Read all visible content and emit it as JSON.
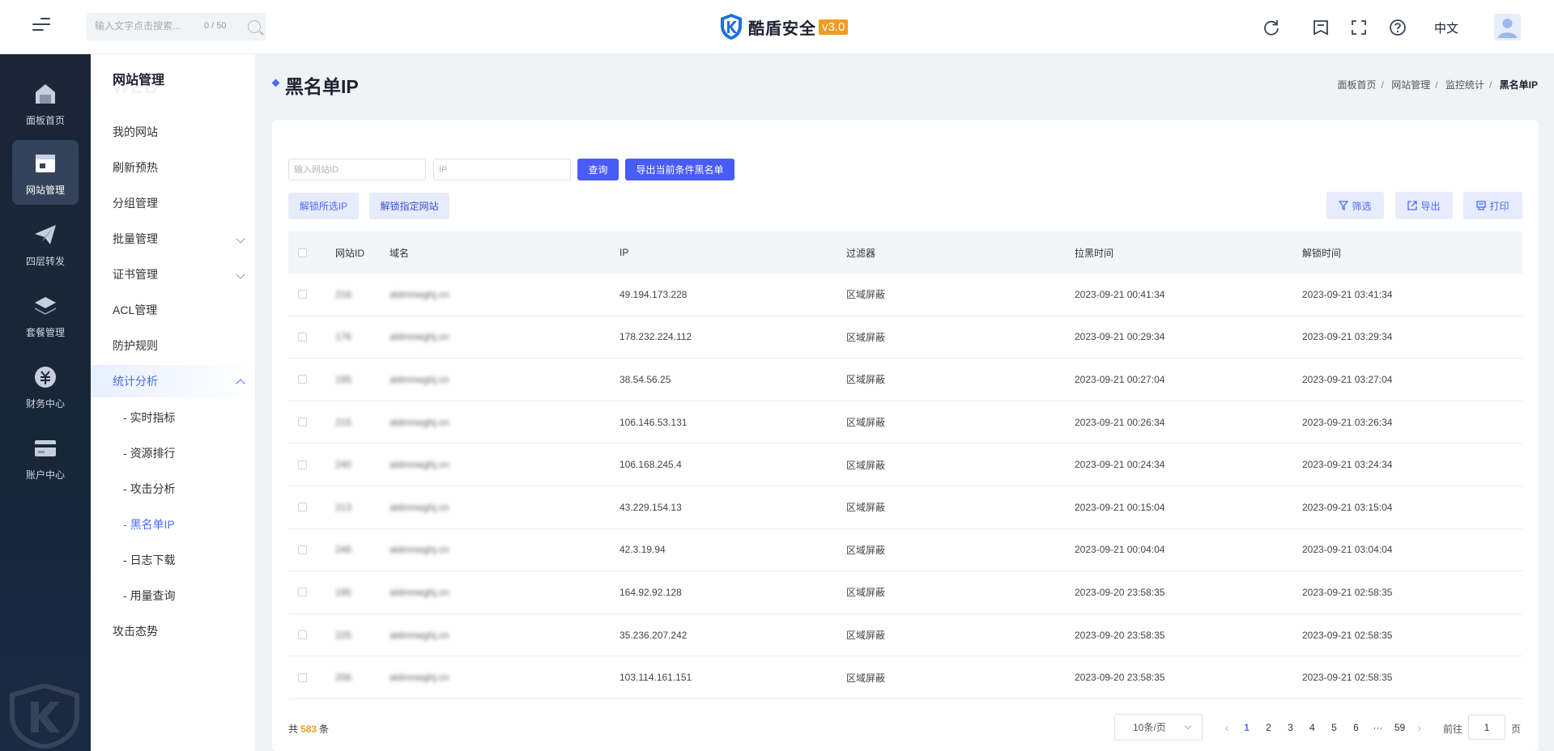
{
  "header": {
    "search_placeholder": "输入文字点击搜索...",
    "search_count": "0 / 50",
    "logo_name": "酷盾安全",
    "logo_version": "v3.0",
    "language": "中文"
  },
  "dark_nav": [
    {
      "label": "面板首页",
      "icon": "home-icon"
    },
    {
      "label": "网站管理",
      "icon": "website-icon"
    },
    {
      "label": "四层转发",
      "icon": "paper-plane-icon"
    },
    {
      "label": "套餐管理",
      "icon": "layers-icon"
    },
    {
      "label": "财务中心",
      "icon": "finance-icon"
    },
    {
      "label": "账户中心",
      "icon": "card-icon"
    }
  ],
  "sub_nav": {
    "title": "网站管理",
    "items": [
      {
        "label": "我的网站"
      },
      {
        "label": "刷新预热"
      },
      {
        "label": "分组管理"
      },
      {
        "label": "批量管理"
      },
      {
        "label": "证书管理"
      },
      {
        "label": "ACL管理"
      },
      {
        "label": "防护规则"
      },
      {
        "label": "统计分析"
      }
    ],
    "sub_items": [
      {
        "label": "实时指标"
      },
      {
        "label": "资源排行"
      },
      {
        "label": "攻击分析"
      },
      {
        "label": "黑名单IP"
      },
      {
        "label": "日志下载"
      },
      {
        "label": "用量查询"
      }
    ],
    "last_item": "攻击态势"
  },
  "page": {
    "title": "黑名单IP",
    "breadcrumb": [
      "面板首页",
      "网站管理",
      "监控统计",
      "黑名单IP"
    ]
  },
  "filters": {
    "site_id_placeholder": "输入网站ID",
    "ip_placeholder": "IP",
    "query_label": "查询",
    "export_label": "导出当前条件黑名单",
    "unlock_ip_label": "解锁所选IP",
    "unlock_site_label": "解锁指定网站",
    "filter_label": "筛选",
    "export_tool_label": "导出",
    "print_label": "打印"
  },
  "table": {
    "columns": [
      "网站ID",
      "域名",
      "IP",
      "过滤器",
      "拉黑时间",
      "解锁时间"
    ],
    "rows": [
      {
        "site_id": "216",
        "domain": "aldmnwghj.cn",
        "ip": "49.194.173.228",
        "filter": "区域屏蔽",
        "block_time": "2023-09-21 00:41:34",
        "unlock_time": "2023-09-21 03:41:34"
      },
      {
        "site_id": "176",
        "domain": "aldmnwghj.cn",
        "ip": "178.232.224.112",
        "filter": "区域屏蔽",
        "block_time": "2023-09-21 00:29:34",
        "unlock_time": "2023-09-21 03:29:34"
      },
      {
        "site_id": "195",
        "domain": "aldmnwghj.cn",
        "ip": "38.54.56.25",
        "filter": "区域屏蔽",
        "block_time": "2023-09-21 00:27:04",
        "unlock_time": "2023-09-21 03:27:04"
      },
      {
        "site_id": "215",
        "domain": "aldmnwghj.cn",
        "ip": "106.146.53.131",
        "filter": "区域屏蔽",
        "block_time": "2023-09-21 00:26:34",
        "unlock_time": "2023-09-21 03:26:34"
      },
      {
        "site_id": "240",
        "domain": "aldmnwghj.cn",
        "ip": "106.168.245.4",
        "filter": "区域屏蔽",
        "block_time": "2023-09-21 00:24:34",
        "unlock_time": "2023-09-21 03:24:34"
      },
      {
        "site_id": "213",
        "domain": "aldmnwghj.cn",
        "ip": "43.229.154.13",
        "filter": "区域屏蔽",
        "block_time": "2023-09-21 00:15:04",
        "unlock_time": "2023-09-21 03:15:04"
      },
      {
        "site_id": "246",
        "domain": "aldmnwghj.cn",
        "ip": "42.3.19.94",
        "filter": "区域屏蔽",
        "block_time": "2023-09-21 00:04:04",
        "unlock_time": "2023-09-21 03:04:04"
      },
      {
        "site_id": "195",
        "domain": "aldmnwghj.cn",
        "ip": "164.92.92.128",
        "filter": "区域屏蔽",
        "block_time": "2023-09-20 23:58:35",
        "unlock_time": "2023-09-21 02:58:35"
      },
      {
        "site_id": "225",
        "domain": "aldmnwghj.cn",
        "ip": "35.236.207.242",
        "filter": "区域屏蔽",
        "block_time": "2023-09-20 23:58:35",
        "unlock_time": "2023-09-21 02:58:35"
      },
      {
        "site_id": "206",
        "domain": "aldmnwghj.cn",
        "ip": "103.114.161.151",
        "filter": "区域屏蔽",
        "block_time": "2023-09-20 23:58:35",
        "unlock_time": "2023-09-21 02:58:35"
      }
    ]
  },
  "pagination": {
    "total_prefix": "共",
    "total": "583",
    "total_suffix": "条",
    "page_size": "10条/页",
    "pages": [
      "1",
      "2",
      "3",
      "4",
      "5",
      "6",
      "···",
      "59"
    ],
    "current": "1",
    "goto_prefix": "前往",
    "goto_value": "1",
    "goto_suffix": "页"
  },
  "colors": {
    "primary": "#4a5cf7",
    "accent_orange": "#f29b22",
    "dark_sidebar": "#1b2638"
  }
}
